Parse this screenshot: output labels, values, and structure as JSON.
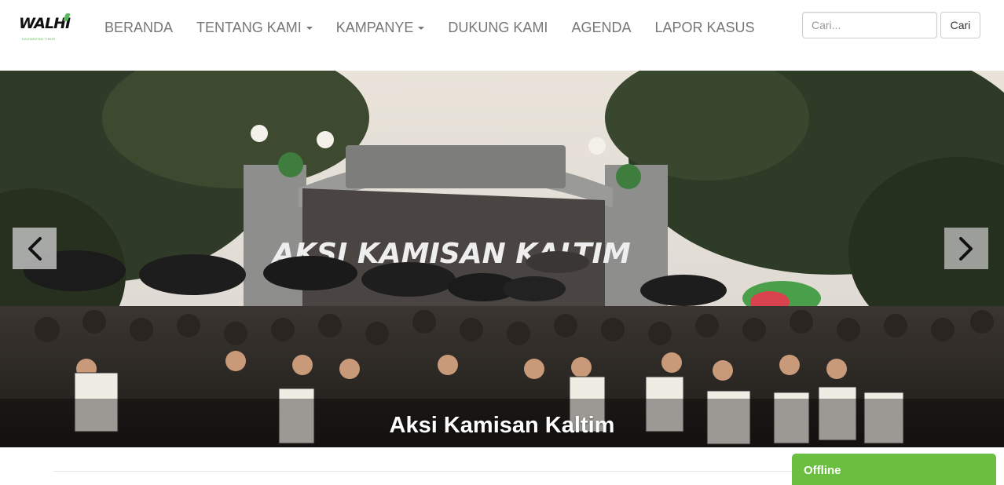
{
  "logo": {
    "text": "WALHI",
    "subtitle": "KALIMANTAN TIMUR"
  },
  "nav": {
    "items": [
      {
        "label": "BERANDA",
        "has_dropdown": false
      },
      {
        "label": "TENTANG KAMI",
        "has_dropdown": true
      },
      {
        "label": "KAMPANYE",
        "has_dropdown": true
      },
      {
        "label": "DUKUNG KAMI",
        "has_dropdown": false
      },
      {
        "label": "AGENDA",
        "has_dropdown": false
      },
      {
        "label": "LAPOR KASUS",
        "has_dropdown": false
      }
    ]
  },
  "search": {
    "placeholder": "Cari...",
    "button_label": "Cari"
  },
  "carousel": {
    "banner_text": "AKSI KAMISAN KALTIM",
    "caption": "Aksi Kamisan Kaltim",
    "prev_icon": "chevron-left-icon",
    "next_icon": "chevron-right-icon"
  },
  "chat": {
    "status_label": "Offline"
  },
  "colors": {
    "nav_text": "#777777",
    "brand_green": "#5cb85c",
    "offline_green": "#6abf40"
  }
}
